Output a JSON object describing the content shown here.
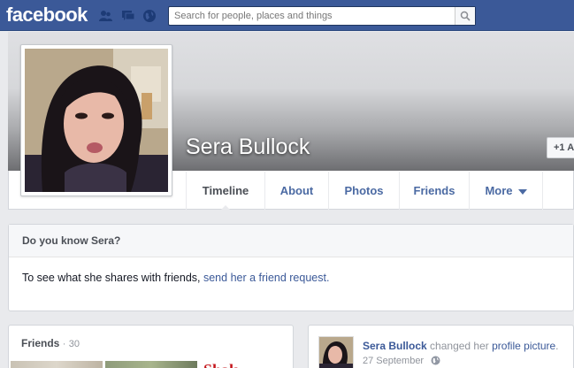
{
  "topbar": {
    "logo": "facebook",
    "search_placeholder": "Search for people, places and things",
    "icons": [
      "friends-icon",
      "messages-icon",
      "notifications-icon",
      "search-icon"
    ]
  },
  "profile": {
    "name": "Sera Bullock",
    "follow_label": "+1 A"
  },
  "tabs": [
    {
      "label": "Timeline",
      "active": true
    },
    {
      "label": "About"
    },
    {
      "label": "Photos"
    },
    {
      "label": "Friends"
    },
    {
      "label": "More"
    }
  ],
  "know": {
    "title": "Do you know Sera?",
    "text": "To see what she shares with friends,",
    "link": "send her a friend request."
  },
  "friends": {
    "title": "Friends",
    "separator": "·",
    "count": "30",
    "thumb3_text": "Shak"
  },
  "story": {
    "name": "Sera Bullock",
    "action": "changed her",
    "object": "profile picture",
    "end": ".",
    "date": "27 September"
  },
  "colors": {
    "brand": "#3b5998",
    "background": "#e9eaed",
    "link": "#4b6aa3"
  }
}
